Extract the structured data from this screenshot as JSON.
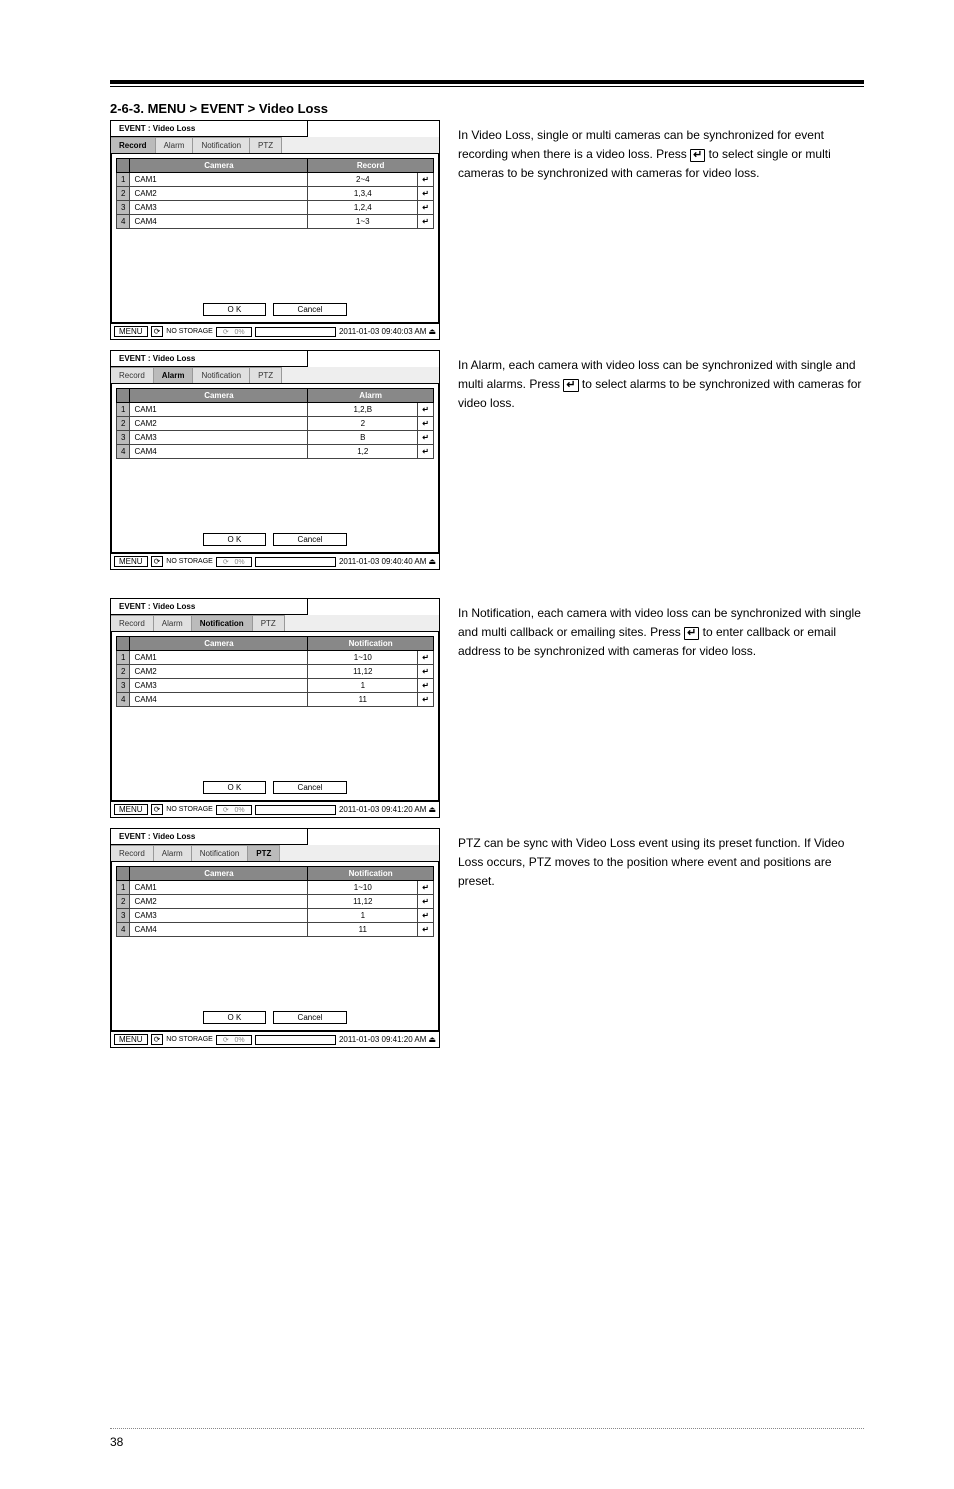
{
  "section_title": "2-6-3. MENU > EVENT > Video Loss",
  "dialogs": {
    "common": {
      "title": "EVENT : Video Loss",
      "cols": {
        "camera": "Camera"
      },
      "tabs": {
        "record": "Record",
        "alarm": "Alarm",
        "notification": "Notification",
        "ptz": "PTZ"
      },
      "ok": "O K",
      "cancel": "Cancel",
      "menu": "MENU",
      "storage": "NO STORAGE",
      "pct_symbol": "⟳"
    },
    "record": {
      "value_header": "Record",
      "rows": [
        {
          "n": "1",
          "cam": "CAM1",
          "val": "2~4"
        },
        {
          "n": "2",
          "cam": "CAM2",
          "val": "1,3,4"
        },
        {
          "n": "3",
          "cam": "CAM3",
          "val": "1,2,4"
        },
        {
          "n": "4",
          "cam": "CAM4",
          "val": "1~3"
        }
      ],
      "timestamp": "2011-01-03 09:40:03 AM"
    },
    "alarm": {
      "value_header": "Alarm",
      "rows": [
        {
          "n": "1",
          "cam": "CAM1",
          "val": "1,2,B"
        },
        {
          "n": "2",
          "cam": "CAM2",
          "val": "2"
        },
        {
          "n": "3",
          "cam": "CAM3",
          "val": "B"
        },
        {
          "n": "4",
          "cam": "CAM4",
          "val": "1,2"
        }
      ],
      "timestamp": "2011-01-03 09:40:40 AM"
    },
    "notification": {
      "value_header": "Notification",
      "rows": [
        {
          "n": "1",
          "cam": "CAM1",
          "val": "1~10"
        },
        {
          "n": "2",
          "cam": "CAM2",
          "val": "11,12"
        },
        {
          "n": "3",
          "cam": "CAM3",
          "val": "1"
        },
        {
          "n": "4",
          "cam": "CAM4",
          "val": "11"
        }
      ],
      "timestamp": "2011-01-03 09:41:20 AM"
    },
    "ptz": {
      "value_header": "Notification",
      "rows": [
        {
          "n": "1",
          "cam": "CAM1",
          "val": "1~10"
        },
        {
          "n": "2",
          "cam": "CAM2",
          "val": "11,12"
        },
        {
          "n": "3",
          "cam": "CAM3",
          "val": "1"
        },
        {
          "n": "4",
          "cam": "CAM4",
          "val": "11"
        }
      ],
      "timestamp": "2011-01-03 09:41:20 AM"
    }
  },
  "descriptions": {
    "record_1": "In Video Loss, single or multi cameras can be synchronized for event recording when there is a video loss. Press ",
    "record_2": " to select single or multi cameras to be synchronized with cameras for video loss.",
    "alarm_1": "In Alarm, each camera with video loss can be synchronized with single and multi alarms. Press ",
    "alarm_2": " to select alarms to be synchronized with cameras for video loss.",
    "notification_1": "In Notification, each camera with video loss can be synchronized with single and multi callback or emailing sites. Press ",
    "notification_2": " to enter callback or email address to be synchronized with cameras for video loss.",
    "ptz": "PTZ can be sync with Video Loss event using its preset function. If Video Loss occurs, PTZ moves to the position where event and positions are preset."
  },
  "enter_glyph": "↵",
  "page_number": "38"
}
